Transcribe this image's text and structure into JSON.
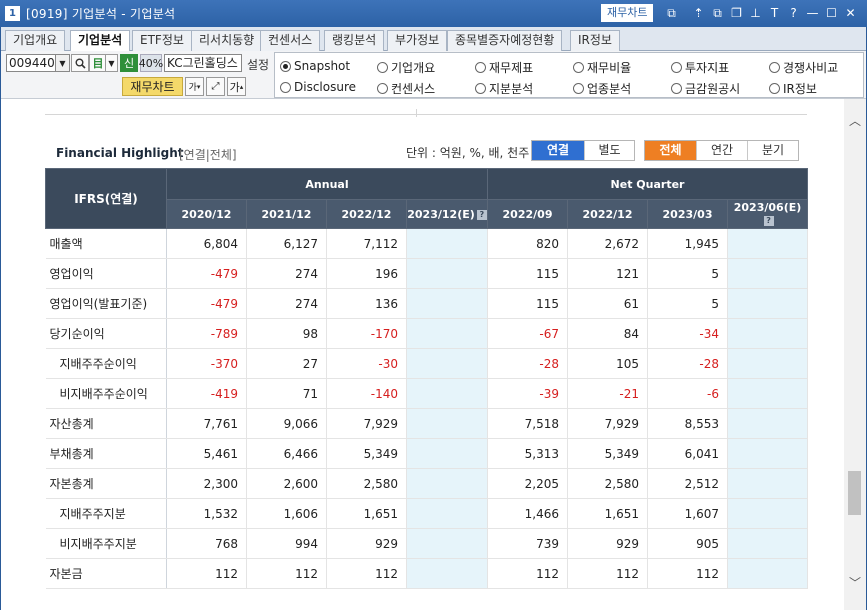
{
  "window": {
    "number": "1",
    "title": "[0919] 기업분석 - 기업분석",
    "finance_chart_btn": "재무차트",
    "icons": [
      "chart-icon",
      "pin-up-icon",
      "window-link-icon",
      "window-copy-icon",
      "pin-icon",
      "text-icon",
      "help-icon",
      "minimize-icon",
      "maximize-icon",
      "close-icon"
    ],
    "icon_glyphs": [
      "⧉",
      "⇡",
      "⧉",
      "❐",
      "⊥",
      "T",
      "?",
      "—",
      "☐",
      "✕"
    ]
  },
  "tabs": [
    "기업개요",
    "기업분석",
    "ETF정보",
    "리서치동향",
    "컨센서스",
    "랭킹분석",
    "부가정보",
    "종목별증자예정현황",
    "IR정보"
  ],
  "active_tab": "기업분석",
  "controls": {
    "code": "009440",
    "shin": "신",
    "pct": "40%",
    "stock_name": "KC그린홀딩스",
    "setting": "설정",
    "finance_chart": "재무차트",
    "font_small": "가",
    "font_large": "가"
  },
  "radios": [
    {
      "label": "Snapshot",
      "checked": true
    },
    {
      "label": "기업개요",
      "checked": false
    },
    {
      "label": "재무제표",
      "checked": false
    },
    {
      "label": "재무비율",
      "checked": false
    },
    {
      "label": "투자지표",
      "checked": false
    },
    {
      "label": "경쟁사비교",
      "checked": false
    },
    {
      "label": "Disclosure",
      "checked": false
    },
    {
      "label": "컨센서스",
      "checked": false
    },
    {
      "label": "지분분석",
      "checked": false
    },
    {
      "label": "업종분석",
      "checked": false
    },
    {
      "label": "금감원공시",
      "checked": false
    },
    {
      "label": "IR정보",
      "checked": false
    }
  ],
  "highlight": {
    "title": "Financial Highlight",
    "subtitle": "[연결|전체]",
    "unit": "단위 : 억원, %, 배, 천주",
    "scope_buttons": [
      "연결",
      "별도"
    ],
    "scope_active": "연결",
    "period_buttons": [
      "전체",
      "연간",
      "분기"
    ],
    "period_active": "전체"
  },
  "table": {
    "corner": "IFRS(연결)",
    "group_annual": "Annual",
    "group_quarter": "Net Quarter",
    "columns": [
      "2020/12",
      "2021/12",
      "2022/12",
      "2023/12(E)",
      "2022/09",
      "2022/12",
      "2023/03",
      "2023/06(E)"
    ],
    "rows": [
      {
        "label": "매출액",
        "indent": false,
        "values": [
          "6,804",
          "6,127",
          "7,112",
          "",
          "820",
          "2,672",
          "1,945",
          ""
        ]
      },
      {
        "label": "영업이익",
        "indent": false,
        "values": [
          "-479",
          "274",
          "196",
          "",
          "115",
          "121",
          "5",
          ""
        ]
      },
      {
        "label": "영업이익(발표기준)",
        "indent": false,
        "values": [
          "-479",
          "274",
          "136",
          "",
          "115",
          "61",
          "5",
          ""
        ]
      },
      {
        "label": "당기순이익",
        "indent": false,
        "values": [
          "-789",
          "98",
          "-170",
          "",
          "-67",
          "84",
          "-34",
          ""
        ]
      },
      {
        "label": "지배주주순이익",
        "indent": true,
        "values": [
          "-370",
          "27",
          "-30",
          "",
          "-28",
          "105",
          "-28",
          ""
        ]
      },
      {
        "label": "비지배주주순이익",
        "indent": true,
        "values": [
          "-419",
          "71",
          "-140",
          "",
          "-39",
          "-21",
          "-6",
          ""
        ]
      },
      {
        "label": "자산총계",
        "indent": false,
        "values": [
          "7,761",
          "9,066",
          "7,929",
          "",
          "7,518",
          "7,929",
          "8,553",
          ""
        ]
      },
      {
        "label": "부채총계",
        "indent": false,
        "values": [
          "5,461",
          "6,466",
          "5,349",
          "",
          "5,313",
          "5,349",
          "6,041",
          ""
        ]
      },
      {
        "label": "자본총계",
        "indent": false,
        "values": [
          "2,300",
          "2,600",
          "2,580",
          "",
          "2,205",
          "2,580",
          "2,512",
          ""
        ]
      },
      {
        "label": "지배주주지분",
        "indent": true,
        "values": [
          "1,532",
          "1,606",
          "1,651",
          "",
          "1,466",
          "1,651",
          "1,607",
          ""
        ]
      },
      {
        "label": "비지배주주지분",
        "indent": true,
        "values": [
          "768",
          "994",
          "929",
          "",
          "739",
          "929",
          "905",
          ""
        ]
      },
      {
        "label": "자본금",
        "indent": false,
        "values": [
          "112",
          "112",
          "112",
          "",
          "112",
          "112",
          "112",
          ""
        ]
      }
    ]
  }
}
